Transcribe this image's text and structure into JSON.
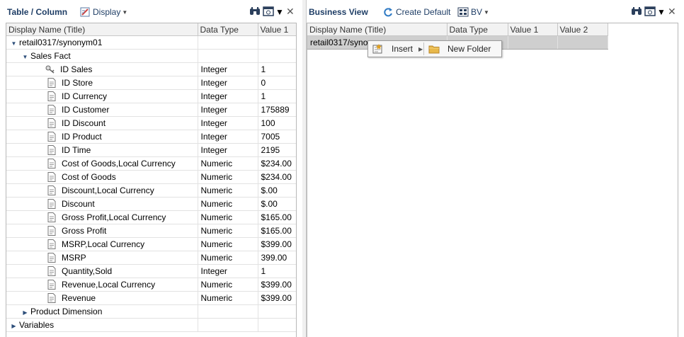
{
  "left_panel": {
    "title": "Table / Column",
    "display_label": "Display",
    "columns": [
      "Display Name (Title)",
      "Data Type",
      "Value 1"
    ],
    "rows": [
      {
        "name": "retail0317/synonym01",
        "type": "",
        "value": "",
        "level": 0,
        "kind": "expanded"
      },
      {
        "name": "Sales Fact",
        "type": "",
        "value": "",
        "level": 1,
        "kind": "expanded"
      },
      {
        "name": "ID Sales",
        "type": "Integer",
        "value": "1",
        "level": 2,
        "kind": "key"
      },
      {
        "name": "ID Store",
        "type": "Integer",
        "value": "0",
        "level": 2,
        "kind": "field"
      },
      {
        "name": "ID Currency",
        "type": "Integer",
        "value": "1",
        "level": 2,
        "kind": "field"
      },
      {
        "name": "ID Customer",
        "type": "Integer",
        "value": "175889",
        "level": 2,
        "kind": "field"
      },
      {
        "name": "ID Discount",
        "type": "Integer",
        "value": "100",
        "level": 2,
        "kind": "field"
      },
      {
        "name": "ID Product",
        "type": "Integer",
        "value": "7005",
        "level": 2,
        "kind": "field"
      },
      {
        "name": "ID Time",
        "type": "Integer",
        "value": "2195",
        "level": 2,
        "kind": "field"
      },
      {
        "name": "Cost of Goods,Local Currency",
        "type": "Numeric",
        "value": "$234.00",
        "level": 2,
        "kind": "field"
      },
      {
        "name": "Cost of Goods",
        "type": "Numeric",
        "value": "$234.00",
        "level": 2,
        "kind": "field"
      },
      {
        "name": "Discount,Local Currency",
        "type": "Numeric",
        "value": "$.00",
        "level": 2,
        "kind": "field"
      },
      {
        "name": "Discount",
        "type": "Numeric",
        "value": "$.00",
        "level": 2,
        "kind": "field"
      },
      {
        "name": "Gross Profit,Local Currency",
        "type": "Numeric",
        "value": "$165.00",
        "level": 2,
        "kind": "field"
      },
      {
        "name": "Gross Profit",
        "type": "Numeric",
        "value": "$165.00",
        "level": 2,
        "kind": "field"
      },
      {
        "name": "MSRP,Local Currency",
        "type": "Numeric",
        "value": "$399.00",
        "level": 2,
        "kind": "field"
      },
      {
        "name": "MSRP",
        "type": "Numeric",
        "value": "399.00",
        "level": 2,
        "kind": "field"
      },
      {
        "name": "Quantity,Sold",
        "type": "Integer",
        "value": "1",
        "level": 2,
        "kind": "field"
      },
      {
        "name": "Revenue,Local Currency",
        "type": "Numeric",
        "value": "$399.00",
        "level": 2,
        "kind": "field"
      },
      {
        "name": "Revenue",
        "type": "Numeric",
        "value": "$399.00",
        "level": 2,
        "kind": "field"
      },
      {
        "name": "Product Dimension",
        "type": "",
        "value": "",
        "level": 1,
        "kind": "collapsed"
      },
      {
        "name": "Variables",
        "type": "",
        "value": "",
        "level": 0,
        "kind": "collapsed"
      }
    ]
  },
  "right_panel": {
    "title": "Business View",
    "create_default_label": "Create Default",
    "bv_label": "BV",
    "columns": [
      "Display Name (Title)",
      "Data Type",
      "Value 1",
      "Value 2"
    ],
    "rows": [
      {
        "name": "retail0317/syno",
        "type": "",
        "value1": "",
        "value2": ""
      }
    ]
  },
  "context_menu": {
    "insert_label": "Insert",
    "new_folder_label": "New Folder"
  },
  "icons": {
    "display": "display-icon",
    "create_default": "refresh-icon",
    "bv": "bv-icon",
    "find": "binoculars-icon",
    "view": "view-icon",
    "close": "close-icon",
    "key": "key-icon",
    "field": "field-icon",
    "folder": "folder-icon"
  },
  "colors": {
    "title_text": "#1f3e66",
    "header_bg": "#f2f2f2",
    "selected_row": "#cfcfcf",
    "tree_arrow": "#2d4e7a",
    "folder": "#e8b84a"
  }
}
